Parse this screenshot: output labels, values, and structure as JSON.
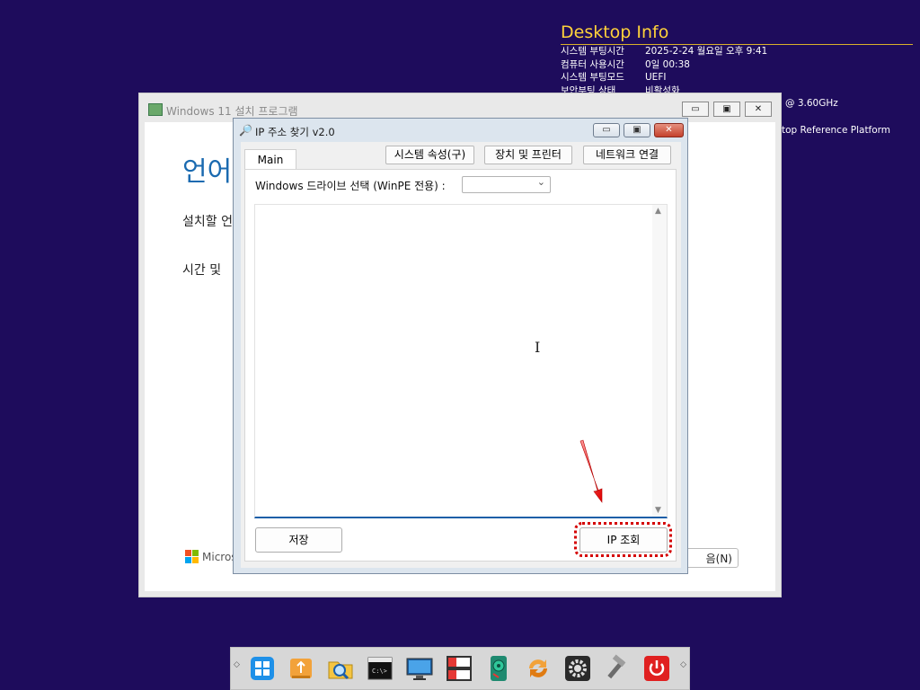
{
  "desktop_info": {
    "title": "Desktop Info",
    "rows": [
      {
        "label": "시스템 부팅시간",
        "value": "2025-2-24 월요일 오후 9:41"
      },
      {
        "label": "컴퓨터 사용시간",
        "value": "0일 00:38"
      },
      {
        "label": "시스템 부팅모드",
        "value": "UEFI"
      },
      {
        "label": "보안부팅 상태",
        "value": "비활성화"
      }
    ],
    "cpu_fragment": "@ 3.60GHz",
    "platform_fragment": "top Reference Platform"
  },
  "setup_window": {
    "title": "Windows 11 설치 프로그램",
    "heading": "언어",
    "line1": "설치할 언",
    "line2": "시간 및",
    "ms_logo_text": "Micros",
    "next_button": "음(N)",
    "controls": {
      "minimize": "▭",
      "maximize": "▣",
      "close": "✕"
    }
  },
  "ip_dialog": {
    "title": "IP 주소 찾기 v2.0",
    "tab_main": "Main",
    "buttons": {
      "system_props": "시스템 속성(구)",
      "devices_printers": "장치 및 프린터",
      "network_connections": "네트워크 연결",
      "save": "저장",
      "ip_lookup": "IP 조회"
    },
    "drive_label": "Windows 드라이브 선택 (WinPE 전용) :",
    "drive_select_value": "",
    "output_text": "",
    "controls": {
      "minimize": "▭",
      "maximize": "▣",
      "close": "✕"
    }
  },
  "taskbar": {
    "items": [
      "windows-start-icon",
      "usb-icon",
      "search-folder-icon",
      "command-prompt-icon",
      "monitor-icon",
      "disk-manager-icon",
      "hard-disk-icon",
      "sync-icon",
      "settings-icon",
      "tools-icon",
      "power-icon"
    ]
  }
}
